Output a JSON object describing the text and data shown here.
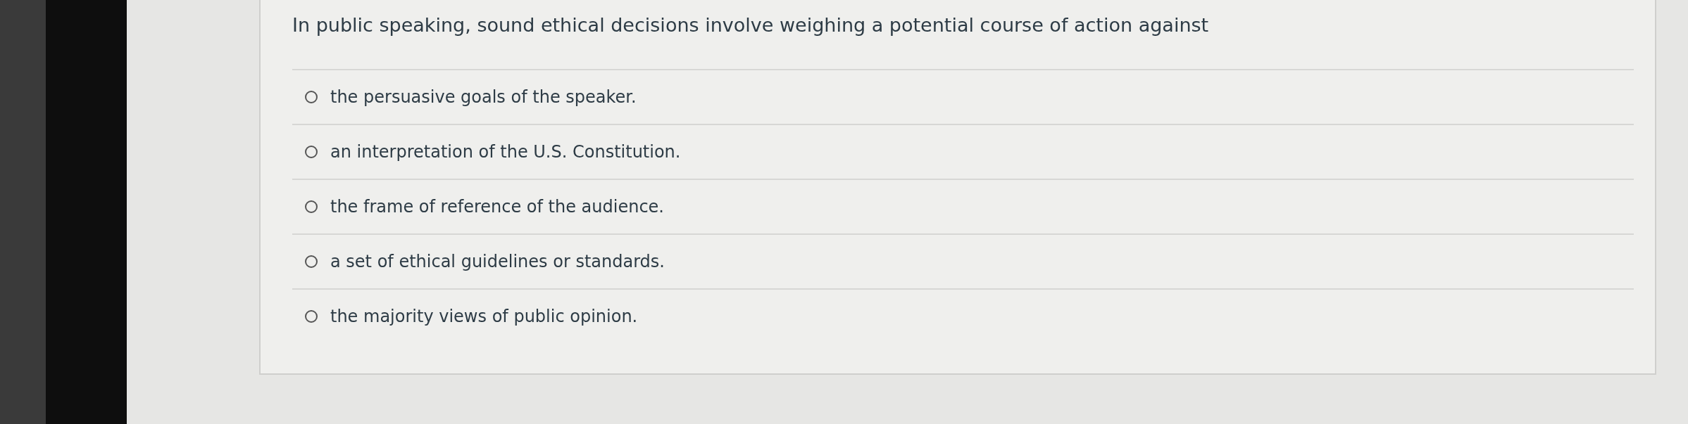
{
  "question": {
    "prompt": "In public speaking, sound ethical decisions involve weighing a potential course of action against",
    "options": [
      {
        "label": "the persuasive goals of the speaker.",
        "selected": false
      },
      {
        "label": "an interpretation of the U.S. Constitution.",
        "selected": false
      },
      {
        "label": "the frame of reference of the audience.",
        "selected": false
      },
      {
        "label": "a set of ethical guidelines or standards.",
        "selected": false
      },
      {
        "label": "the majority views of public opinion.",
        "selected": false
      }
    ]
  }
}
